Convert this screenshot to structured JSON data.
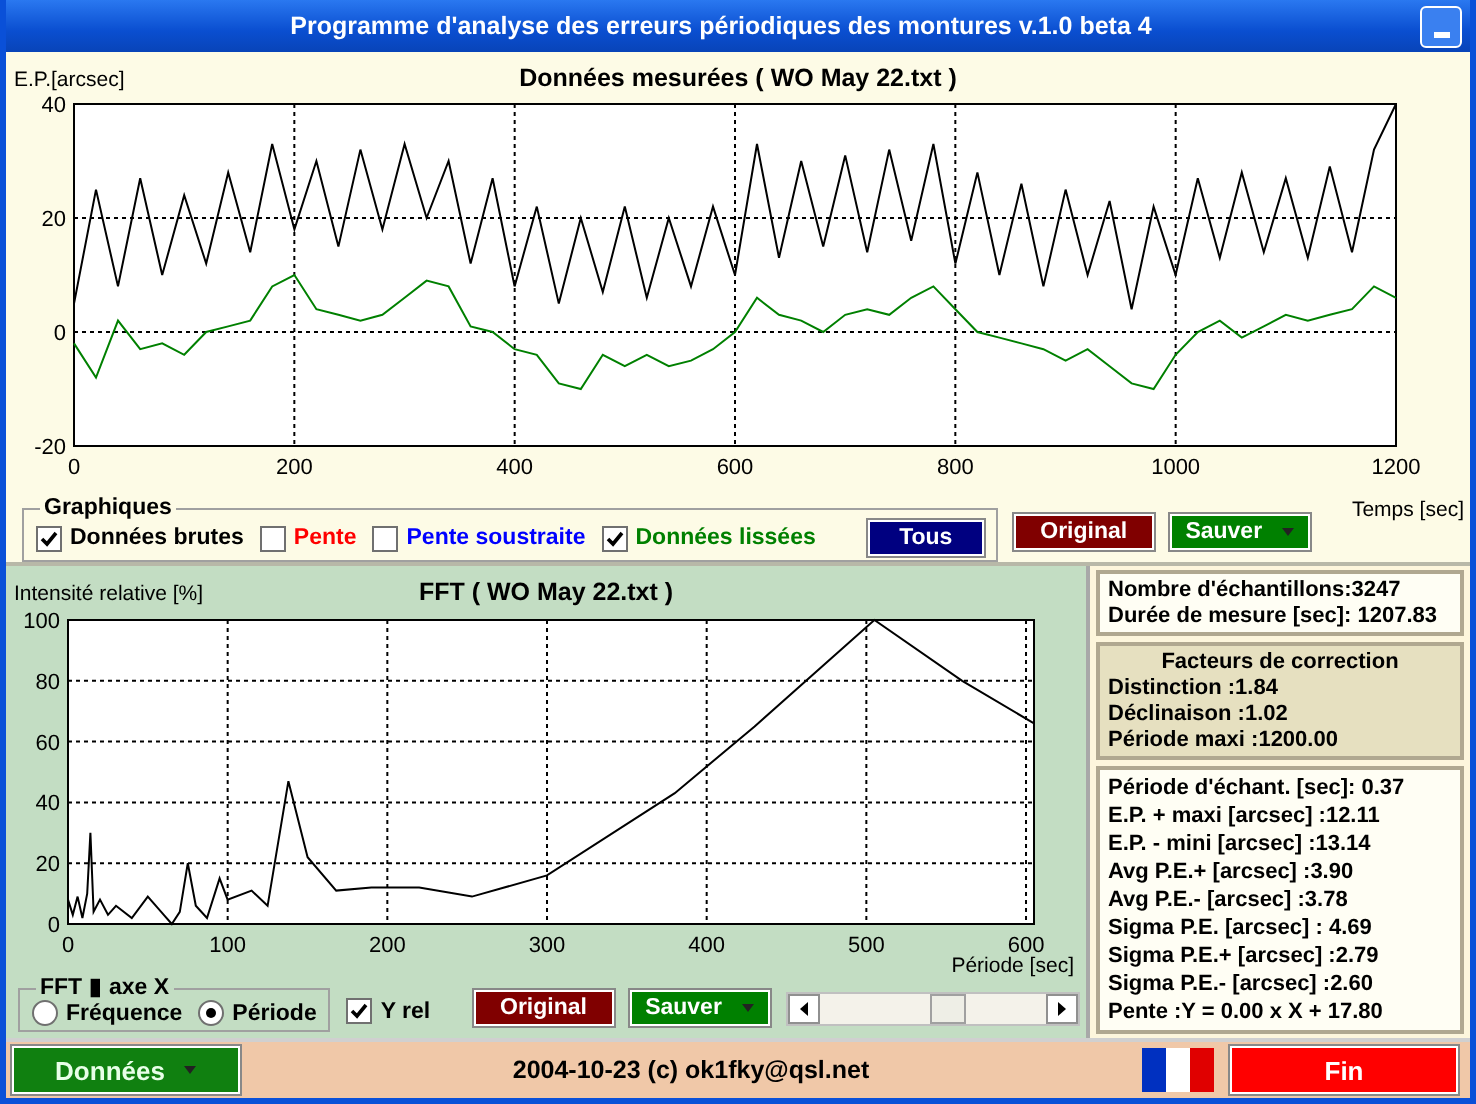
{
  "window": {
    "title": "Programme d'analyse des erreurs périodiques des montures v.1.0 beta 4"
  },
  "measured": {
    "chart_data": {
      "type": "line",
      "title": "Données mesurées ( WO May 22.txt )",
      "xlabel": "Temps [sec]",
      "ylabel": "E.P.[arcsec]",
      "x": [
        0,
        20,
        40,
        60,
        80,
        100,
        120,
        140,
        160,
        180,
        200,
        220,
        240,
        260,
        280,
        300,
        320,
        340,
        360,
        380,
        400,
        420,
        440,
        460,
        480,
        500,
        520,
        540,
        560,
        580,
        600,
        620,
        640,
        660,
        680,
        700,
        720,
        740,
        760,
        780,
        800,
        820,
        840,
        860,
        880,
        900,
        920,
        940,
        960,
        980,
        1000,
        1020,
        1040,
        1060,
        1080,
        1100,
        1120,
        1140,
        1160,
        1180,
        1200
      ],
      "series": [
        {
          "color": "#000000",
          "values": [
            5,
            25,
            8,
            27,
            10,
            24,
            12,
            28,
            14,
            33,
            18,
            30,
            15,
            32,
            18,
            33,
            20,
            30,
            12,
            27,
            8,
            22,
            5,
            20,
            7,
            22,
            6,
            20,
            8,
            22,
            10,
            33,
            13,
            30,
            15,
            31,
            14,
            32,
            16,
            33,
            12,
            28,
            10,
            26,
            8,
            25,
            10,
            23,
            4,
            22,
            10,
            27,
            13,
            28,
            14,
            27,
            13,
            29,
            14,
            32,
            40
          ]
        },
        {
          "color": "#008000",
          "values": [
            -2,
            -8,
            2,
            -3,
            -2,
            -4,
            0,
            1,
            2,
            8,
            10,
            4,
            3,
            2,
            3,
            6,
            9,
            8,
            1,
            0,
            -3,
            -4,
            -9,
            -10,
            -4,
            -6,
            -4,
            -6,
            -5,
            -3,
            0,
            6,
            3,
            2,
            0,
            3,
            4,
            3,
            6,
            8,
            4,
            0,
            -1,
            -2,
            -3,
            -5,
            -3,
            -6,
            -9,
            -10,
            -4,
            0,
            2,
            -1,
            1,
            3,
            2,
            3,
            4,
            8,
            6
          ]
        }
      ],
      "xlim": [
        0,
        1200
      ],
      "ylim": [
        -20,
        40
      ],
      "grid": true,
      "xticks": [
        0,
        200,
        400,
        600,
        800,
        1000,
        1200
      ],
      "yticks": [
        -20,
        0,
        20,
        40
      ]
    }
  },
  "graphics": {
    "title": "Graphiques",
    "items": [
      {
        "label": "Données brutes",
        "checked": true,
        "color": "#000000"
      },
      {
        "label": "Pente",
        "checked": false,
        "color": "#ff0000"
      },
      {
        "label": "Pente soustraite",
        "checked": false,
        "color": "#0000ff"
      },
      {
        "label": "Données lissées",
        "checked": true,
        "color": "#008000"
      }
    ],
    "button": {
      "label": "Tous",
      "color": "#000080"
    }
  },
  "top_buttons": [
    {
      "label": "Original",
      "color": "#800000",
      "dropdown": false
    },
    {
      "label": "Sauver",
      "color": "#008000",
      "dropdown": true
    }
  ],
  "fft": {
    "chart_data": {
      "type": "line",
      "title": "FFT ( WO May 22.txt )",
      "xlabel": "Période [sec]",
      "ylabel": "Intensité relative [%]",
      "x": [
        0,
        3,
        6,
        9,
        12,
        14,
        16,
        20,
        25,
        30,
        40,
        50,
        60,
        65,
        70,
        75,
        80,
        87,
        95,
        100,
        115,
        125,
        138,
        150,
        168,
        190,
        220,
        253,
        300,
        380,
        430,
        505,
        560,
        605
      ],
      "series": [
        {
          "color": "#000000",
          "values": [
            8,
            3,
            9,
            2,
            10,
            30,
            4,
            8,
            3,
            6,
            2,
            9,
            3,
            0,
            4,
            20,
            6,
            2,
            15,
            8,
            11,
            6,
            47,
            22,
            11,
            12,
            12,
            9,
            16,
            43,
            65,
            100,
            80,
            66
          ]
        }
      ],
      "xlim": [
        0,
        605
      ],
      "ylim": [
        0,
        100
      ],
      "grid": true,
      "xticks": [
        0,
        100,
        200,
        300,
        400,
        500,
        600
      ],
      "yticks": [
        0,
        20,
        40,
        60,
        80,
        100
      ]
    }
  },
  "fft_axis": {
    "title": "FFT ▮ axe X",
    "options": [
      {
        "label": "Fréquence",
        "selected": false
      },
      {
        "label": "Période",
        "selected": true
      }
    ]
  },
  "y_rel": {
    "label": "Y rel",
    "checked": true
  },
  "fft_buttons": [
    {
      "label": "Original",
      "color": "#800000",
      "dropdown": false
    },
    {
      "label": "Sauver",
      "color": "#008000",
      "dropdown": true
    }
  ],
  "stats": {
    "summary": [
      "Nombre d'échantillons:3247",
      "Durée de mesure [sec]: 1207.83"
    ],
    "correction": {
      "title": "Facteurs de correction",
      "lines": [
        "Distinction :1.84",
        "Déclinaison :1.02",
        "Période maxi :1200.00"
      ]
    },
    "details": [
      "Période d'échant. [sec]: 0.37",
      "E.P. + maxi [arcsec] :12.11",
      "E.P. - mini [arcsec] :13.14",
      "Avg P.E.+ [arcsec] :3.90",
      "Avg P.E.- [arcsec] :3.78",
      "Sigma P.E. [arcsec] : 4.69",
      "Sigma P.E.+ [arcsec] :2.79",
      "Sigma P.E.- [arcsec] :2.60",
      "Pente :Y = 0.00 x X + 17.80"
    ]
  },
  "footer": {
    "menu_button": "Données",
    "credit": "2004-10-23 (c) ok1fky@qsl.net",
    "exit_button": "Fin"
  }
}
